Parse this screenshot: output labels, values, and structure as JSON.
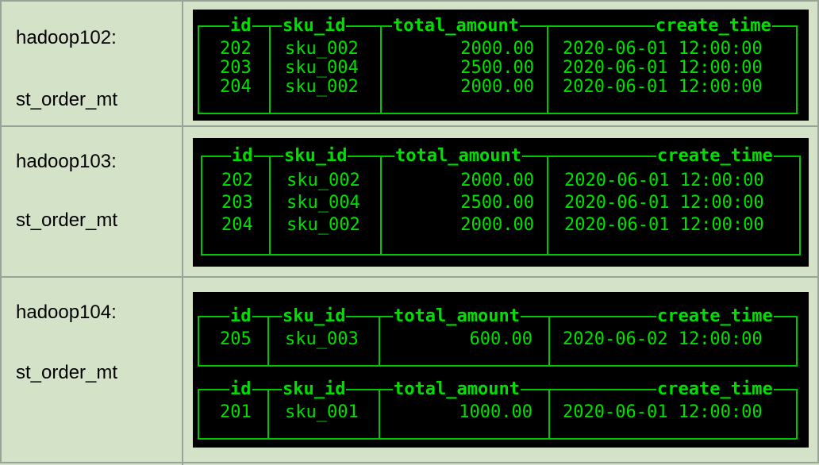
{
  "rows": [
    {
      "host": "hadoop102:",
      "table": "st_order_mt",
      "terminal": {
        "tables": [
          {
            "headers": [
              "id",
              "sku_id",
              "total_amount",
              "create_time"
            ],
            "records": [
              [
                "202",
                "sku_002",
                "2000.00",
                "2020-06-01 12:00:00"
              ],
              [
                "203",
                "sku_004",
                "2500.00",
                "2020-06-01 12:00:00"
              ],
              [
                "204",
                "sku_002",
                "2000.00",
                "2020-06-01 12:00:00"
              ]
            ]
          }
        ]
      }
    },
    {
      "host": "hadoop103:",
      "table": "st_order_mt",
      "terminal": {
        "tables": [
          {
            "headers": [
              "id",
              "sku_id",
              "total_amount",
              "create_time"
            ],
            "records": [
              [
                "202",
                "sku_002",
                "2000.00",
                "2020-06-01 12:00:00"
              ],
              [
                "203",
                "sku_004",
                "2500.00",
                "2020-06-01 12:00:00"
              ],
              [
                "204",
                "sku_002",
                "2000.00",
                "2020-06-01 12:00:00"
              ]
            ]
          }
        ]
      }
    },
    {
      "host": "hadoop104:",
      "table": "st_order_mt",
      "terminal": {
        "tables": [
          {
            "headers": [
              "id",
              "sku_id",
              "total_amount",
              "create_time"
            ],
            "records": [
              [
                "205",
                "sku_003",
                "600.00",
                "2020-06-02 12:00:00"
              ]
            ]
          },
          {
            "headers": [
              "id",
              "sku_id",
              "total_amount",
              "create_time"
            ],
            "records": [
              [
                "201",
                "sku_001",
                "1000.00",
                "2020-06-01 12:00:00"
              ]
            ]
          }
        ]
      }
    }
  ],
  "colors": {
    "terminal_bg": "#000000",
    "terminal_fg": "#00e000",
    "cell_bg": "#d4e3c8"
  }
}
